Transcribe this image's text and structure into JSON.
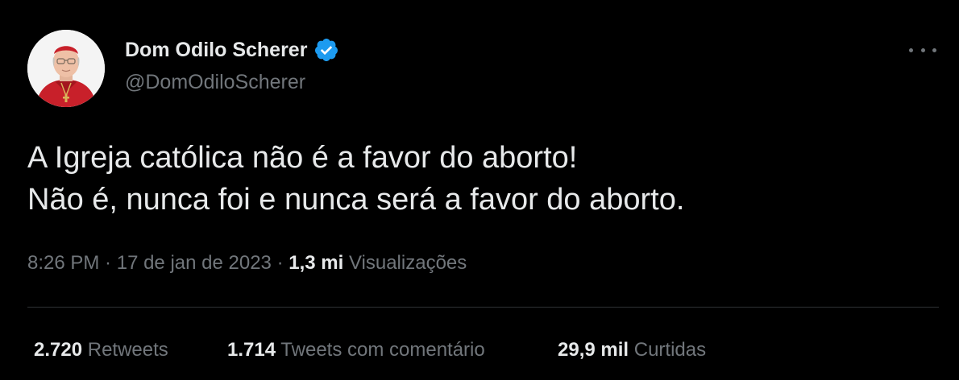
{
  "author": {
    "display_name": "Dom Odilo Scherer",
    "handle": "@DomOdiloScherer",
    "verified": true,
    "verified_color": "#1d9bf0",
    "avatar_icon": "avatar-photo"
  },
  "more_icon": "more-options-icon",
  "tweet": {
    "line1": "A Igreja católica não é a favor do aborto!",
    "line2": "Não é, nunca foi e nunca será a favor do aborto."
  },
  "meta": {
    "time": "8:26 PM",
    "separator1": " · ",
    "date": "17 de jan de 2023",
    "separator2": " · ",
    "views_count": "1,3 mi",
    "views_label": "Visualizações"
  },
  "stats": {
    "retweets_count": "2.720",
    "retweets_label": "Retweets",
    "quotes_count": "1.714",
    "quotes_label": "Tweets com comentário",
    "likes_count": "29,9 mil",
    "likes_label": "Curtidas"
  },
  "colors": {
    "background": "#000000",
    "primary_text": "#e7e9ea",
    "secondary_text": "#71767b",
    "divider": "#2f3336"
  }
}
